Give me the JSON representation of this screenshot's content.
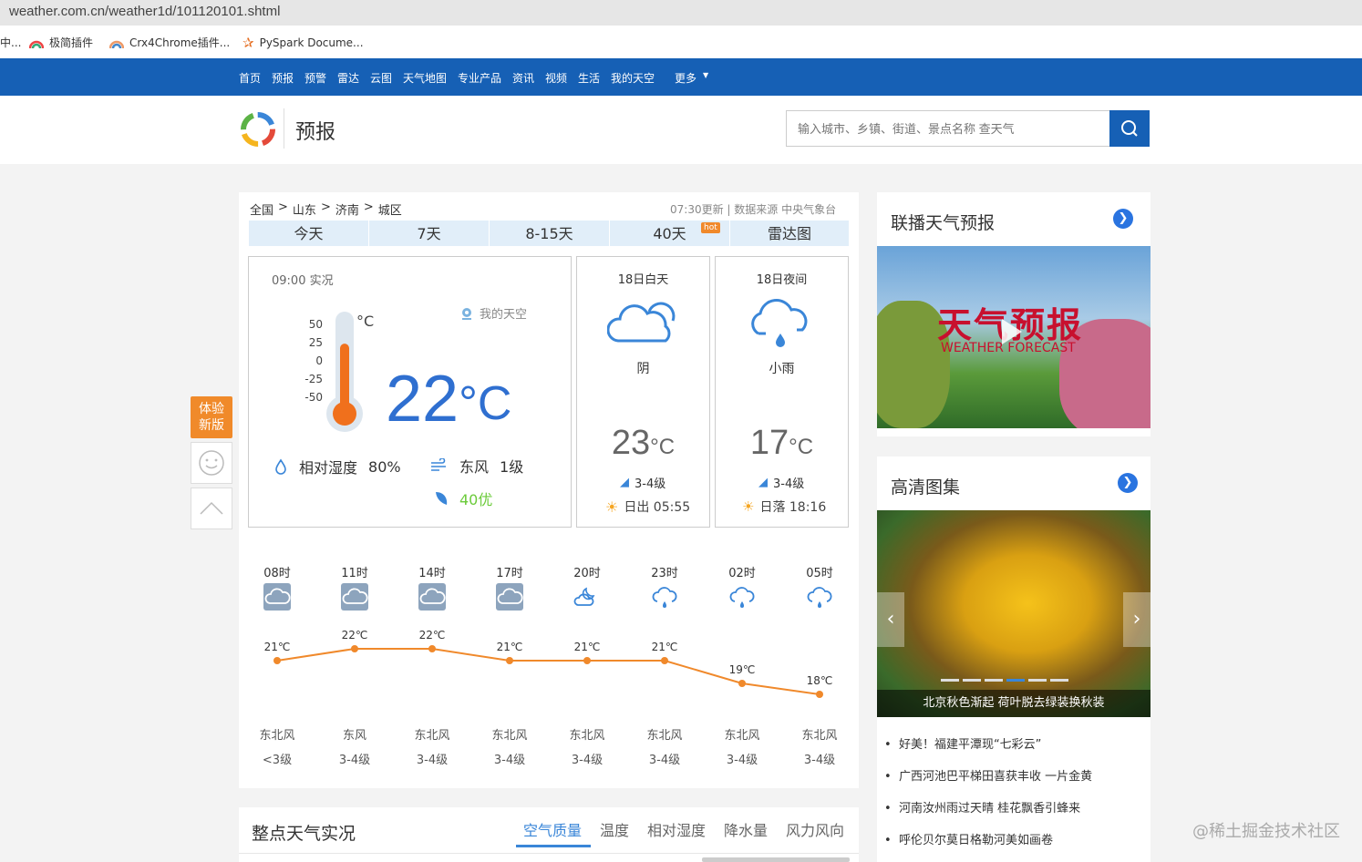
{
  "browser": {
    "url": "weather.com.cn/weather1d/101120101.shtml",
    "bookmarks": [
      "中...",
      "极简插件",
      "Crx4Chrome插件...",
      "PySpark Docume..."
    ]
  },
  "nav": {
    "items": [
      "首页",
      "预报",
      "预警",
      "雷达",
      "云图",
      "天气地图",
      "专业产品",
      "资讯",
      "视频",
      "生活",
      "我的天空",
      "更多"
    ]
  },
  "header": {
    "section_title": "预报",
    "search_placeholder": "输入城市、乡镇、街道、景点名称 查天气"
  },
  "breadcrumb": [
    "全国",
    ">",
    "山东",
    ">",
    "济南",
    ">",
    "城区"
  ],
  "update_info": "07:30更新 | 数据来源 中央气象台",
  "tabs": [
    {
      "label": "今天"
    },
    {
      "label": "7天"
    },
    {
      "label": "8-15天"
    },
    {
      "label": "40天",
      "badge": "hot"
    },
    {
      "label": "雷达图"
    }
  ],
  "current": {
    "time_label": "09:00 实况",
    "my_sky": "我的天空",
    "scale": [
      "50",
      "25",
      "0",
      "-25",
      "-50"
    ],
    "scale_unit": "°C",
    "temp": "22",
    "temp_unit": "°C",
    "thermometer_level": 0.72,
    "humidity_label": "相对湿度",
    "humidity": "80%",
    "wind": "东风",
    "wind_level": "1级",
    "aqi": "40优"
  },
  "day": {
    "title": "18日白天",
    "desc": "阴",
    "temp": "23",
    "unit": "°C",
    "wind": "3-4级",
    "sun": "日出 05:55"
  },
  "night": {
    "title": "18日夜间",
    "desc": "小雨",
    "temp": "17",
    "unit": "°C",
    "wind": "3-4级",
    "sun": "日落 18:16"
  },
  "hourly": {
    "times": [
      "08时",
      "11时",
      "14时",
      "17时",
      "20时",
      "23时",
      "02时",
      "05时"
    ],
    "temps": [
      21,
      22,
      22,
      21,
      21,
      21,
      19,
      18
    ],
    "temp_unit": "℃",
    "icons": [
      "overcast",
      "overcast",
      "overcast",
      "overcast",
      "partly-cloudy-night",
      "light-rain",
      "light-rain",
      "light-rain"
    ],
    "wind_dirs": [
      "东北风",
      "东风",
      "东北风",
      "东北风",
      "东北风",
      "东北风",
      "东北风",
      "东北风"
    ],
    "wind_levels": [
      "<3级",
      "3-4级",
      "3-4级",
      "3-4级",
      "3-4级",
      "3-4级",
      "3-4级",
      "3-4级"
    ]
  },
  "side": {
    "broadcast_title": "联播天气预报",
    "video_title": "天气预报",
    "video_subtitle": "WEATHER FORECAST",
    "gallery_title": "高清图集",
    "gallery_caption": "北京秋色渐起 荷叶脱去绿装换秋装",
    "news": [
      "好美！福建平潭现“七彩云”",
      "广西河池巴平梯田喜获丰收 一片金黄",
      "河南汝州雨过天晴 桂花飘香引蜂来",
      "呼伦贝尔莫日格勒河美如画卷"
    ]
  },
  "float": {
    "new_version": "体验新版"
  },
  "observation": {
    "title": "整点天气实况",
    "tabs": [
      "空气质量",
      "温度",
      "相对湿度",
      "降水量",
      "风力风向"
    ]
  },
  "watermark": "@稀土掘金技术社区",
  "colors": {
    "nav": "#1660b5",
    "accent": "#4a7fd6",
    "line": "#f0892b",
    "aqi": "#6bcb3a",
    "float_btn": "#f08a2a"
  }
}
